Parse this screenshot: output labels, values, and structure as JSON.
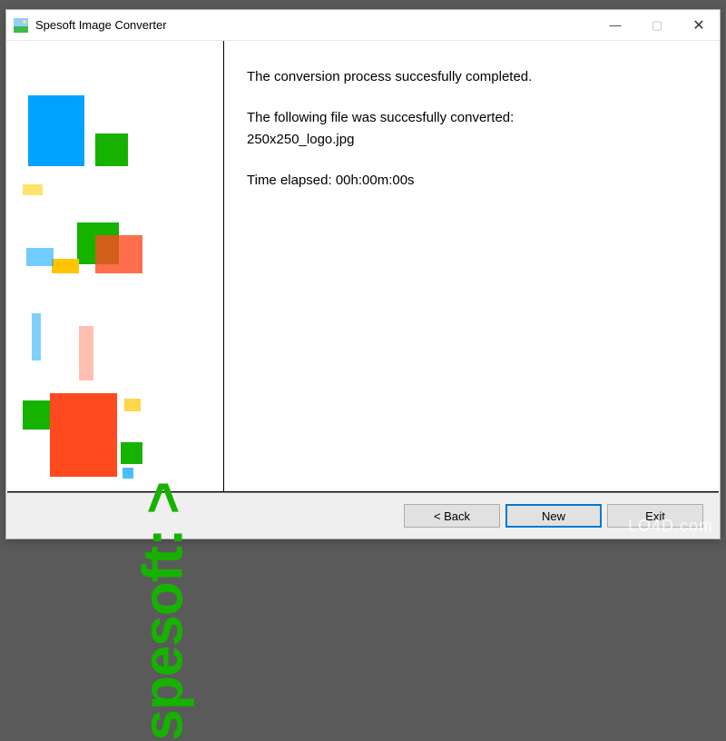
{
  "window": {
    "title": "Spesoft Image Converter",
    "controls": {
      "min": "—",
      "max": "▢",
      "close": "✕"
    }
  },
  "sidebar": {
    "brand": "spesoft: >"
  },
  "content": {
    "line1": "The conversion process succesfully completed.",
    "line2a": "The following file was succesfully converted:",
    "line2b": "250x250_logo.jpg",
    "line3": "Time elapsed: 00h:00m:00s"
  },
  "buttons": {
    "back": "< Back",
    "new": "New",
    "exit": "Exit"
  },
  "watermark": "LO4D.com"
}
